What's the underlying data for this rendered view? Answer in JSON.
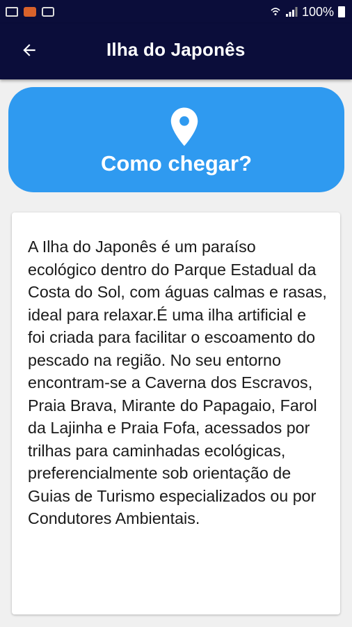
{
  "status_bar": {
    "battery_text": "100%",
    "left_icons": [
      "image-icon",
      "app-notification-icon",
      "voicemail-icon"
    ],
    "right_icons": [
      "wifi-calling-icon",
      "signal-icon",
      "battery-icon"
    ]
  },
  "app_bar": {
    "title": "Ilha do Japonês",
    "background": "#0b0d3a"
  },
  "directions_button": {
    "label": "Como chegar?",
    "icon": "location-pin-icon",
    "color": "#2f9af0"
  },
  "description": {
    "text": "A Ilha do Japonês é um paraíso ecológico dentro do Parque Estadual da Costa do Sol, com águas calmas e rasas, ideal para relaxar.É uma ilha artificial e foi criada para facilitar o escoamento do pescado na região. No seu entorno encontram-se a Caverna dos Escravos, Praia Brava, Mirante do Papagaio, Farol da Lajinha e Praia Fofa, acessados por trilhas para caminhadas ecológicas, preferencialmente sob orientação de Guias de Turismo especializados ou por Condutores Ambientais."
  }
}
